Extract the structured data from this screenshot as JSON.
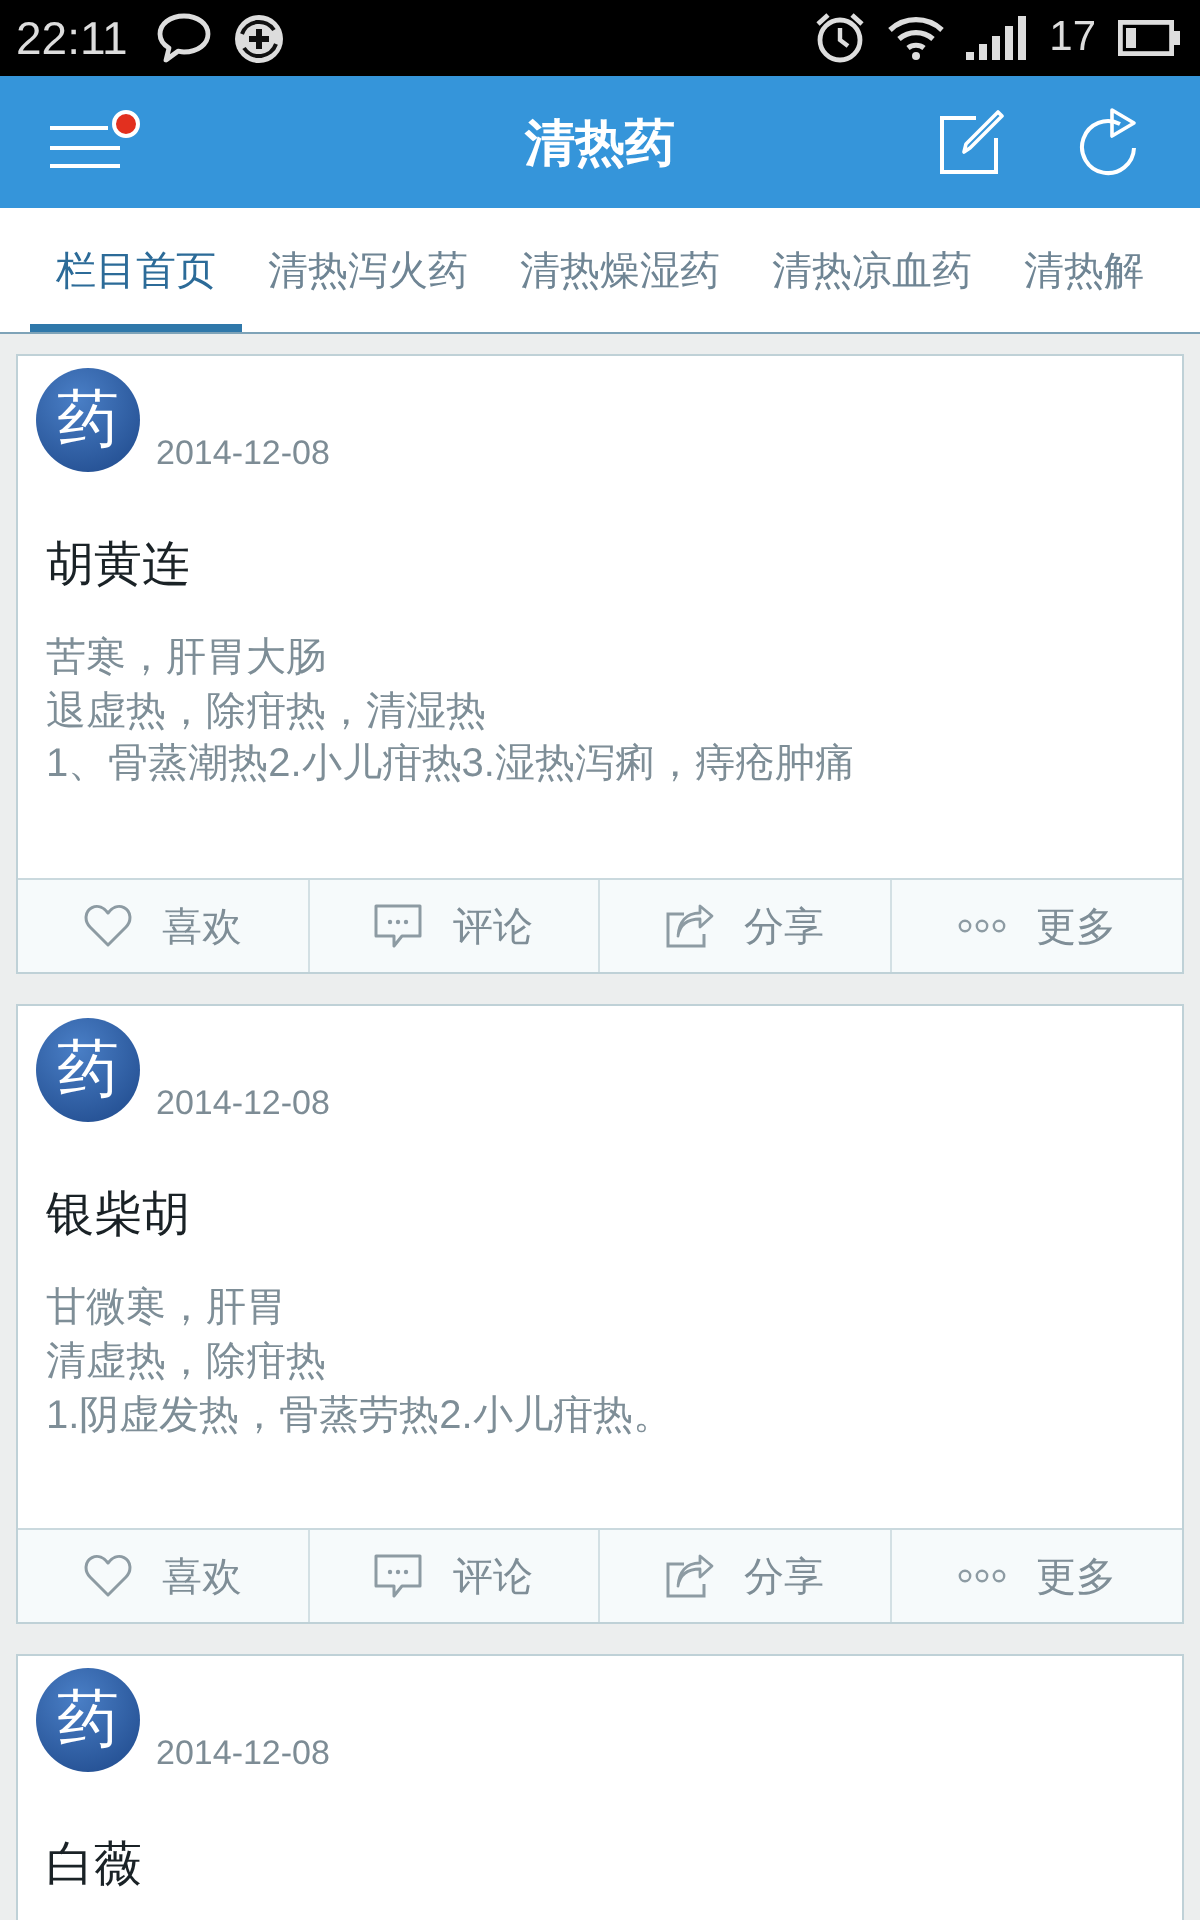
{
  "status_bar": {
    "time": "22:11",
    "battery_percent": "17"
  },
  "app_bar": {
    "title": "清热药",
    "menu_notification": true
  },
  "tabs": [
    {
      "label": "栏目首页",
      "selected": true
    },
    {
      "label": "清热泻火药",
      "selected": false
    },
    {
      "label": "清热燥湿药",
      "selected": false
    },
    {
      "label": "清热凉血药",
      "selected": false
    },
    {
      "label": "清热解",
      "selected": false
    }
  ],
  "cards": [
    {
      "avatar_text": "药",
      "date": "2014-12-08",
      "title": "胡黄连",
      "details": [
        "苦寒，肝胃大肠",
        "退虚热，除疳热，清湿热",
        "1、骨蒸潮热2.小儿疳热3.湿热泻痢，痔疮肿痛"
      ],
      "actions": [
        {
          "kind": "like",
          "label": "喜欢"
        },
        {
          "kind": "comment",
          "label": "评论"
        },
        {
          "kind": "share",
          "label": "分享"
        },
        {
          "kind": "more",
          "label": "更多"
        }
      ]
    },
    {
      "avatar_text": "药",
      "date": "2014-12-08",
      "title": "银柴胡",
      "details": [
        "甘微寒，肝胃",
        "清虚热，除疳热",
        "1.阴虚发热，骨蒸劳热2.小儿疳热。"
      ],
      "actions": [
        {
          "kind": "like",
          "label": "喜欢"
        },
        {
          "kind": "comment",
          "label": "评论"
        },
        {
          "kind": "share",
          "label": "分享"
        },
        {
          "kind": "more",
          "label": "更多"
        }
      ]
    },
    {
      "avatar_text": "药",
      "date": "2014-12-08",
      "title": "白薇"
    }
  ]
}
